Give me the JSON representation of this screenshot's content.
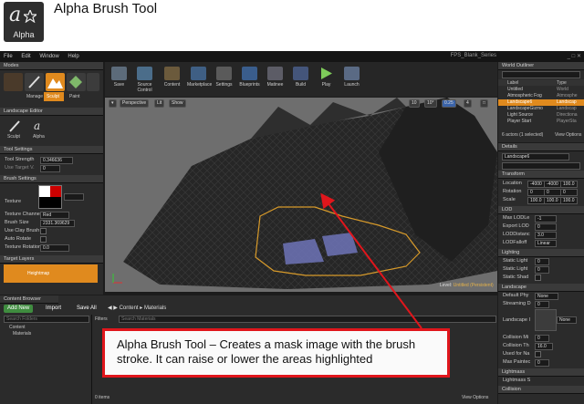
{
  "header": {
    "icon_glyph": "a",
    "icon_label": "Alpha",
    "title": "Alpha Brush Tool"
  },
  "menu": [
    "File",
    "Edit",
    "Window",
    "Help"
  ],
  "project_name": "FPS_Blank_Series",
  "window_controls": "_ □ ✕",
  "modes_panel": {
    "title": "Modes",
    "mode_buttons": [
      "Manage",
      "Sculpt",
      "Paint"
    ],
    "editor_title": "Landscape Editor",
    "tools": [
      "Sculpt",
      "Alpha"
    ],
    "tool_settings_title": "Tool Settings",
    "tool_settings": [
      {
        "label": "Tool Strength",
        "value": "0.346636"
      },
      {
        "label": "Use Target V.",
        "value": "0"
      }
    ],
    "brush_settings_title": "Brush Settings",
    "texture_label": "Texture",
    "brush_settings": [
      {
        "label": "Texture Channel",
        "value": "Red"
      },
      {
        "label": "Brush Size",
        "value": "2331.369629"
      },
      {
        "label": "Use Clay Brush",
        "value": ""
      },
      {
        "label": "Auto Rotate",
        "value": ""
      },
      {
        "label": "Texture Rotation",
        "value": "0.0"
      }
    ],
    "target_layers_title": "Target Layers",
    "heightmap_label": "Heightmap"
  },
  "toolbar": {
    "buttons": [
      "Save",
      "Source Control",
      "Content",
      "Marketplace",
      "Settings",
      "Blueprints",
      "Matinee",
      "Build",
      "Play",
      "Launch"
    ]
  },
  "viewport": {
    "perspective": "Perspective",
    "lit": "Lit",
    "show": "Show",
    "grid_value": "10",
    "angle_value": "10°",
    "scale_value": "0.25",
    "camera_speed": "4",
    "level_label": "Level: ",
    "level_name": "Untitled (Persistent)"
  },
  "world_outliner": {
    "title": "World Outliner",
    "col_label": "Label",
    "col_type": "Type",
    "items": [
      {
        "name": "Untitled",
        "type": "World"
      },
      {
        "name": "Atmospheric Fog",
        "type": "Atmosphe"
      },
      {
        "name": "Landscape6",
        "type": "Landscap"
      },
      {
        "name": "LandscapeGizmo",
        "type": "Landscap"
      },
      {
        "name": "Light Source",
        "type": "Directiona"
      },
      {
        "name": "Player Start",
        "type": "PlayerSta"
      }
    ],
    "status": "6 actors (1 selected)",
    "view_options": "View Options"
  },
  "details": {
    "title": "Details",
    "object_name": "Landscape6",
    "sections": [
      "Transform",
      "LOD",
      "Lighting",
      "Landscape",
      "Lightmass",
      "Collision"
    ],
    "transform": [
      {
        "label": "Location",
        "values": [
          "-4000",
          "-4000",
          "100.0"
        ]
      },
      {
        "label": "Rotation",
        "values": [
          "0",
          "0",
          "0"
        ]
      },
      {
        "label": "Scale",
        "values": [
          "100.0",
          "100.0",
          "100.0"
        ]
      }
    ],
    "lod": [
      {
        "label": "Max LODLe",
        "value": "-1"
      },
      {
        "label": "Export LOD",
        "value": "0"
      },
      {
        "label": "LODDistanc",
        "value": "3.0"
      },
      {
        "label": "LODFalloff",
        "value": "Linear"
      }
    ],
    "lighting": [
      {
        "label": "Static Light",
        "value": "0"
      },
      {
        "label": "Static Light",
        "value": "0"
      },
      {
        "label": "Static Shad",
        "value": ""
      }
    ],
    "landscape": [
      {
        "label": "Default Phy",
        "value": "None"
      },
      {
        "label": "Streaming D",
        "value": "0"
      },
      {
        "label": "Landscape I",
        "value": "None"
      },
      {
        "label": "Collision Mi",
        "value": "0"
      },
      {
        "label": "Collision Th",
        "value": "16.0"
      },
      {
        "label": "Used for Na",
        "value": ""
      },
      {
        "label": "Max Paintec",
        "value": "0"
      }
    ],
    "lightmass": [
      {
        "label": "Lightmass S",
        "value": ""
      }
    ]
  },
  "content_browser": {
    "title": "Content Browser",
    "add_new": "Add New",
    "import": "Import",
    "save_all": "Save All",
    "breadcrumb": [
      "Content",
      "Materials"
    ],
    "search_placeholder": "Search Folders",
    "tree": [
      "Content",
      "Materials"
    ],
    "filters": "Filters",
    "search_assets": "Search Materials",
    "status": "0 items",
    "view_options": "View Options"
  },
  "callout": {
    "text": "Alpha Brush Tool – Creates a mask image with the brush stroke. It can raise or lower the areas highlighted"
  },
  "colors": {
    "accent_orange": "#e08a1e",
    "callout_border": "#e0161c",
    "selection_blue": "#2b5e9e",
    "add_new_green": "#3f8c3f"
  }
}
